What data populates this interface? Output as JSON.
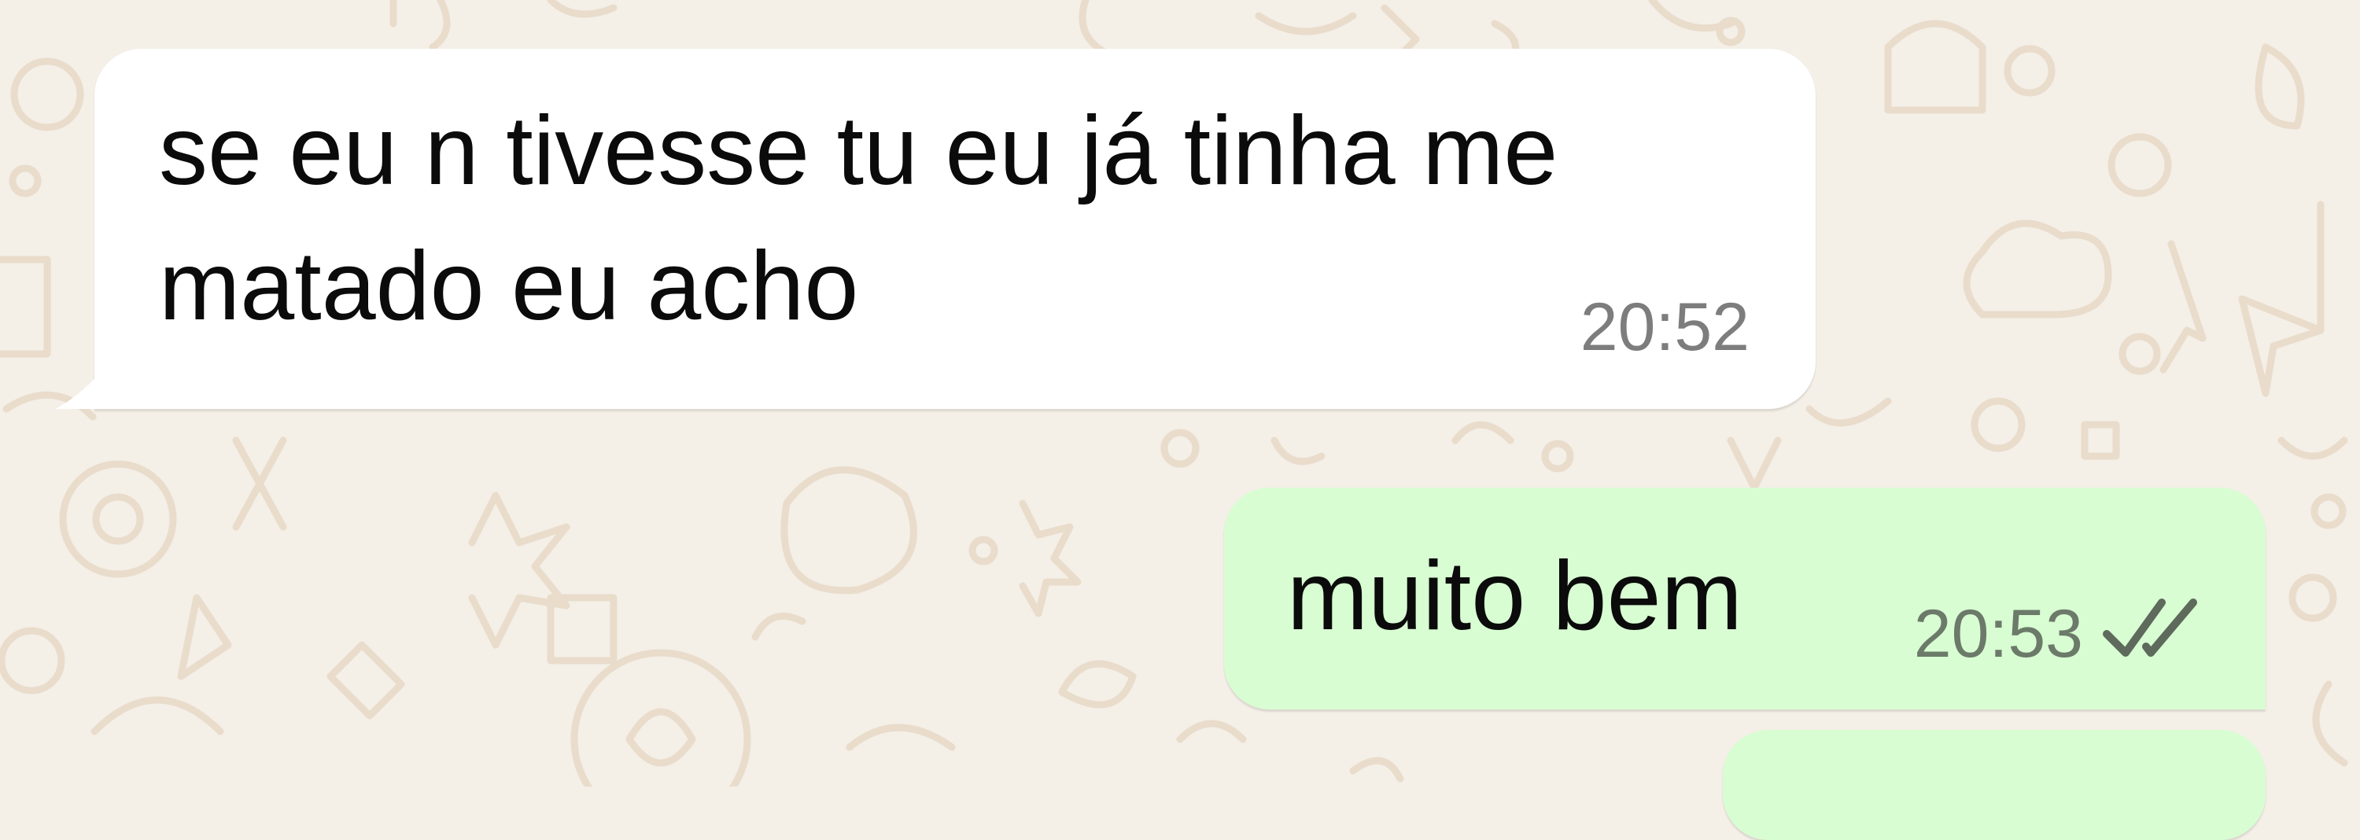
{
  "conversation": {
    "messages": [
      {
        "direction": "incoming",
        "lines": [
          "se eu n tivesse tu eu já tinha me",
          "matado eu acho"
        ],
        "time": "20:52"
      },
      {
        "direction": "outgoing",
        "text": "muito bem",
        "time": "20:53",
        "status": "read",
        "status_icon": "double-check-icon"
      },
      {
        "direction": "outgoing",
        "text": ""
      }
    ]
  },
  "colors": {
    "wallpaper": "#f4efe7",
    "wallpaper_doodle": "#e9dccb",
    "incoming_bubble": "#ffffff",
    "outgoing_bubble": "#d8fdd2",
    "timestamp": "#7d7d7d",
    "read_ticks": "#5e6a5c"
  }
}
